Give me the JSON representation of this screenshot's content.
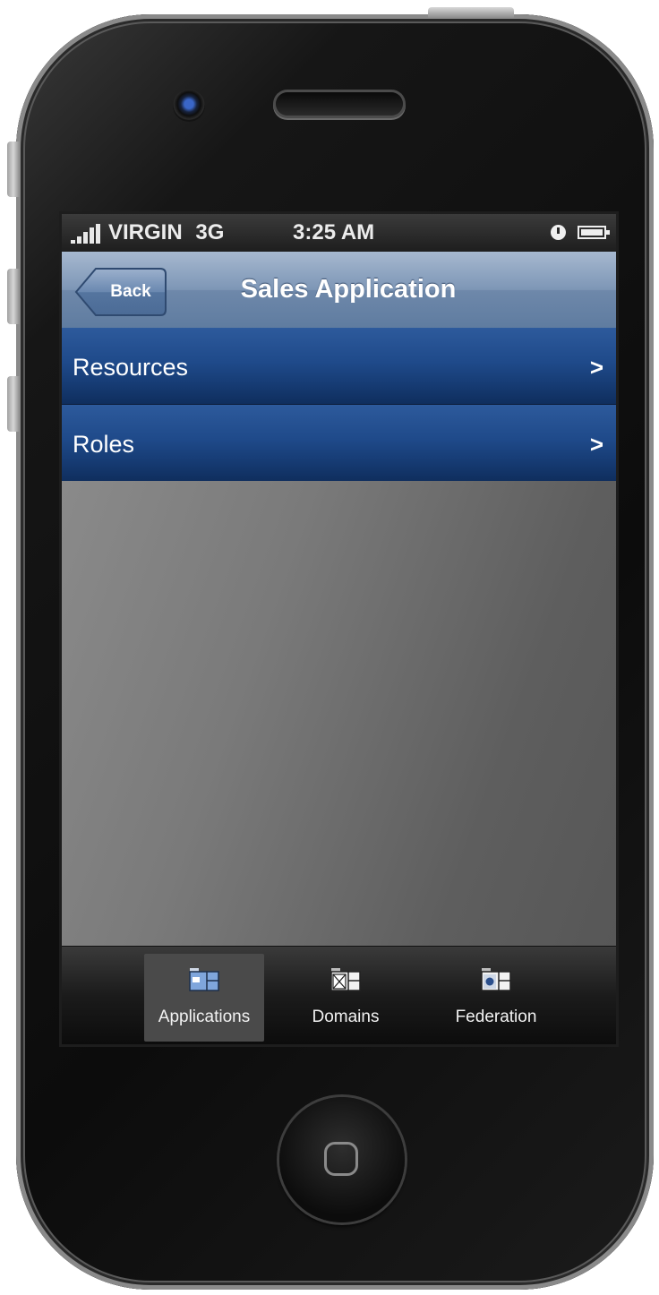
{
  "status_bar": {
    "carrier": "VIRGIN",
    "network": "3G",
    "time": "3:25 AM"
  },
  "nav_bar": {
    "back_label": "Back",
    "title": "Sales Application"
  },
  "list": {
    "items": [
      {
        "label": "Resources",
        "chevron": ">"
      },
      {
        "label": "Roles",
        "chevron": ">"
      }
    ]
  },
  "tab_bar": {
    "tabs": [
      {
        "label": "Applications",
        "icon": "applications-icon",
        "active": true
      },
      {
        "label": "Domains",
        "icon": "domains-icon",
        "active": false
      },
      {
        "label": "Federation",
        "icon": "federation-icon",
        "active": false
      }
    ]
  },
  "colors": {
    "nav_bar": "#7d96b6",
    "list_row": "#1f4a8a",
    "tab_bar": "#1b1b1b"
  }
}
